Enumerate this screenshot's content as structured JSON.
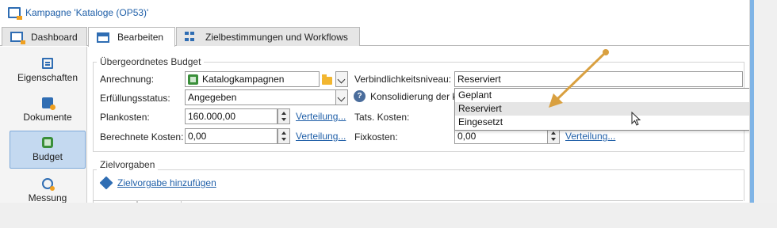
{
  "window": {
    "title": "Kampagne 'Kataloge (OP53)'"
  },
  "tabs": [
    {
      "label": "Dashboard",
      "icon": "dashboard-icon"
    },
    {
      "label": "Bearbeiten",
      "icon": "edit-icon",
      "active": true
    },
    {
      "label": "Zielbestimmungen und Workflows",
      "icon": "workflow-icon"
    }
  ],
  "sidebar": {
    "items": [
      {
        "label": "Eigenschaften",
        "icon": "properties-icon"
      },
      {
        "label": "Dokumente",
        "icon": "documents-icon"
      },
      {
        "label": "Budget",
        "icon": "budget-icon",
        "active": true
      },
      {
        "label": "Messung",
        "icon": "measurement-icon"
      }
    ]
  },
  "budget": {
    "legend": "Übergeordnetes Budget",
    "anrechnung": {
      "label": "Anrechnung:",
      "value": "Katalogkampagnen"
    },
    "erfuellung": {
      "label": "Erfüllungsstatus:",
      "value": "Angegeben"
    },
    "plankosten": {
      "label": "Plankosten:",
      "value": "160.000,00",
      "link": "Verteilung..."
    },
    "berechnete": {
      "label": "Berechnete Kosten:",
      "value": "0,00",
      "link": "Verteilung..."
    },
    "verbindlichkeit": {
      "label": "Verbindlichkeitsniveau:",
      "value": "Reserviert"
    },
    "konsolidierung": {
      "label": "Konsolidierung der k"
    },
    "tats": {
      "label": "Tats. Kosten:"
    },
    "fixkosten": {
      "label": "Fixkosten:",
      "value": "0,00",
      "link": "Verteilung..."
    }
  },
  "dropdown": {
    "options": [
      "Geplant",
      "Reserviert",
      "Eingesetzt"
    ],
    "hovered": "Reserviert"
  },
  "zielvorgaben": {
    "legend": "Zielvorgaben",
    "add_link": "Zielvorgabe hinzufügen"
  },
  "colors": {
    "accent": "#1f5fa8",
    "annotation_arrow": "#d9a040",
    "active_sidebar": "#c4d9f0"
  }
}
